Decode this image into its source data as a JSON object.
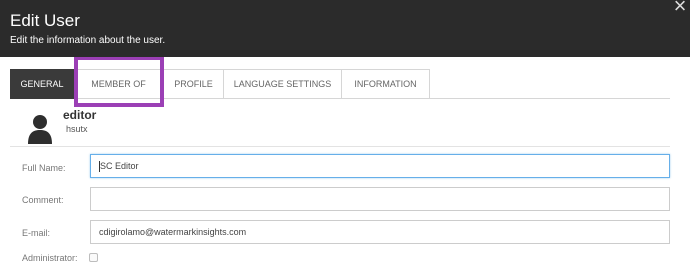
{
  "dialog": {
    "title": "Edit User",
    "subtitle": "Edit the information about the user.",
    "close_glyph": "×"
  },
  "tabs": [
    {
      "label": "GENERAL",
      "active": true
    },
    {
      "label": "MEMBER OF",
      "active": false,
      "highlighted": true
    },
    {
      "label": "PROFILE",
      "active": false
    },
    {
      "label": "LANGUAGE SETTINGS",
      "active": false
    },
    {
      "label": "INFORMATION",
      "active": false
    }
  ],
  "highlight_color": "#9b3fb5",
  "user": {
    "name": "editor",
    "login": "hsutx",
    "avatar_icon": "user-silhouette-icon"
  },
  "form": {
    "full_name": {
      "label": "Full Name:",
      "value": "SC Editor"
    },
    "comment": {
      "label": "Comment:",
      "value": ""
    },
    "email": {
      "label": "E-mail:",
      "value": "cdigirolamo@watermarkinsights.com"
    },
    "administrator": {
      "label": "Administrator:",
      "checked": false
    }
  }
}
